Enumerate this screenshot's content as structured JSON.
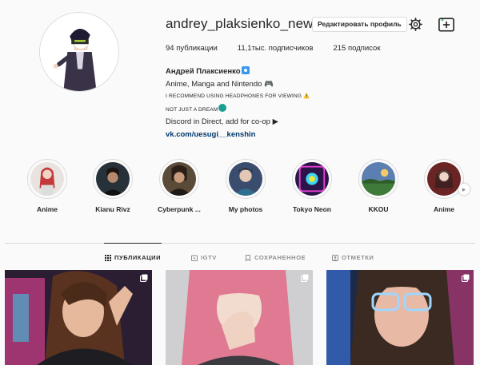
{
  "profile": {
    "username": "andrey_plaksienko_new",
    "edit_label": "Редактировать профиль",
    "stats": {
      "posts": "94 публикации",
      "followers": "11,1тыс. подписчиков",
      "following": "215 подписок"
    },
    "bio": {
      "name": "Андрей Плаксиенко",
      "line1": "Anime, Manga and Nintendo 🎮",
      "line2": "I RECOMMEND USING HEADPHONES FOR VIEWING ⚠️",
      "line3": "NOT JUST A DREAM",
      "line4": "Discord in Direct, add for co-op ▶",
      "link": "vk.com/uesugi__kenshin"
    }
  },
  "highlights": [
    {
      "label": "Anime",
      "color": "#c94a4a"
    },
    {
      "label": "Kianu Rivz",
      "color": "#3a2a22"
    },
    {
      "label": "Cyberpunk ...",
      "color": "#4a3a2c"
    },
    {
      "label": "My photos",
      "color": "#2c3b55"
    },
    {
      "label": "Tokyo Neon",
      "color": "#7a2c9c"
    },
    {
      "label": "KKOU",
      "color": "#3f7a3a"
    },
    {
      "label": "Anime",
      "color": "#a33c3c"
    }
  ],
  "tabs": [
    {
      "label": "ПУБЛИКАЦИИ",
      "icon": "grid-icon",
      "active": true
    },
    {
      "label": "IGTV",
      "icon": "igtv-tab-icon",
      "active": false
    },
    {
      "label": "СОХРАНЕННОЕ",
      "icon": "bookmark-icon",
      "active": false
    },
    {
      "label": "ОТМЕТКИ",
      "icon": "tag-icon",
      "active": false
    }
  ],
  "icons": {
    "settings": "gear-icon",
    "igtv": "igtv-icon",
    "verified": "verified-icon",
    "next": "chevron-right-icon",
    "carousel": "carousel-icon"
  },
  "colors": {
    "background": "#fafafa",
    "text": "#262626",
    "muted": "#8e8e8e",
    "border": "#dbdbdb",
    "link": "#00376b"
  }
}
